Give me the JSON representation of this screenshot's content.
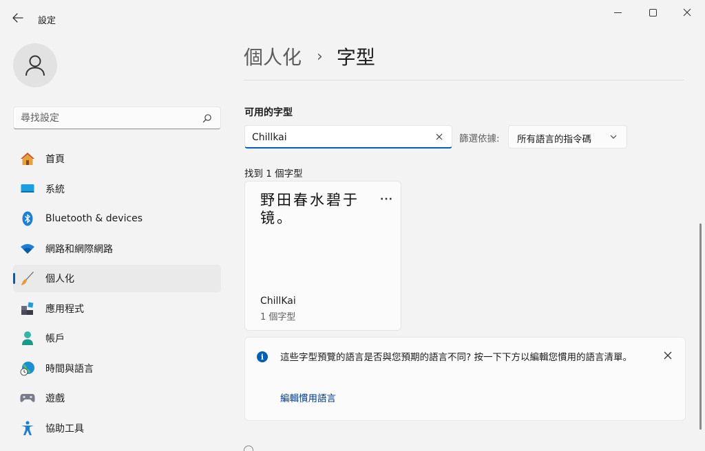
{
  "window": {
    "title": "設定",
    "back_icon": "arrow-left-icon",
    "controls": [
      "minimize-icon",
      "maximize-icon",
      "close-icon"
    ]
  },
  "sidebar": {
    "avatar_icon": "person-icon",
    "search": {
      "placeholder": "尋找設定",
      "icon": "search-icon"
    },
    "items": [
      {
        "label": "首頁",
        "icon": "home-icon"
      },
      {
        "label": "系統",
        "icon": "monitor-icon"
      },
      {
        "label": "Bluetooth & devices",
        "icon": "bluetooth-icon"
      },
      {
        "label": "網路和網際網路",
        "icon": "wifi-icon"
      },
      {
        "label": "個人化",
        "icon": "paintbrush-icon",
        "active": true
      },
      {
        "label": "應用程式",
        "icon": "apps-icon"
      },
      {
        "label": "帳戶",
        "icon": "account-icon"
      },
      {
        "label": "時間與語言",
        "icon": "globe-clock-icon"
      },
      {
        "label": "遊戲",
        "icon": "gamepad-icon"
      },
      {
        "label": "協助工具",
        "icon": "accessibility-icon"
      }
    ]
  },
  "main": {
    "breadcrumb": {
      "parent": "個人化",
      "separator": "›",
      "current": "字型"
    },
    "section_title": "可用的字型",
    "font_search": {
      "value": "Chillkai",
      "clear_icon": "close-icon"
    },
    "filter": {
      "label": "篩選依據:",
      "value": "所有語言的指令碼",
      "icon": "chevron-down-icon"
    },
    "found_text": "找到 1 個字型",
    "font_card": {
      "preview": "野田春水碧于镜。",
      "more_label": "···",
      "name": "ChillKai",
      "count": "1 個字型"
    },
    "info": {
      "icon": "info-icon",
      "text": "這些字型預覽的語言是否與您預期的語言不同? 按一下下方以編輯您慣用的語言清單。",
      "link": "編輯慣用語言",
      "close_icon": "close-icon"
    }
  },
  "colors": {
    "accent": "#005fb8",
    "link": "#003e92",
    "background": "#f3f3f3",
    "card": "#fbfbfb"
  }
}
